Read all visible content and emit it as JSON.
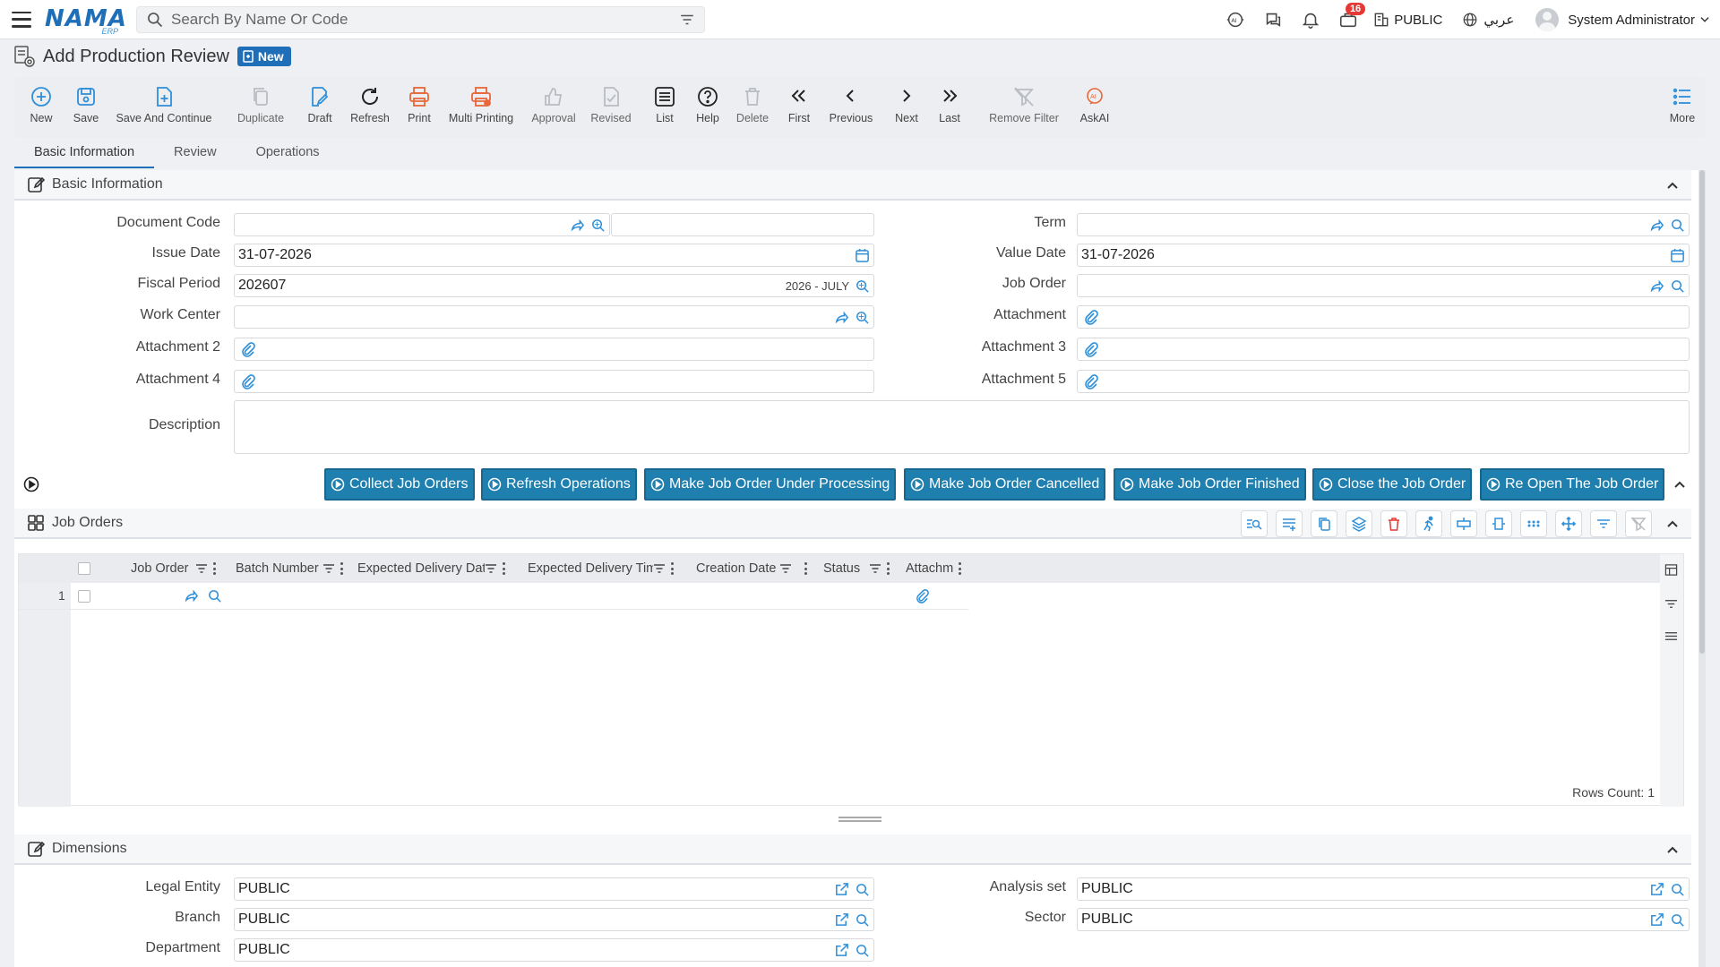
{
  "topbar": {
    "logo_text": "NAMA",
    "logo_sub": "ERP",
    "search_placeholder": "Search By Name Or Code",
    "notifications_count": "16",
    "company": "PUBLIC",
    "language": "عربي",
    "user_name": "System Administrator"
  },
  "page": {
    "title": "Add Production Review",
    "status_badge": "New"
  },
  "toolbar": {
    "new": "New",
    "save": "Save",
    "save_continue": "Save And Continue",
    "duplicate": "Duplicate",
    "draft": "Draft",
    "refresh": "Refresh",
    "print": "Print",
    "multi_printing": "Multi Printing",
    "approval": "Approval",
    "revised": "Revised",
    "list": "List",
    "help": "Help",
    "delete": "Delete",
    "first": "First",
    "previous": "Previous",
    "next": "Next",
    "last": "Last",
    "remove_filter": "Remove Filter",
    "askai": "AskAI",
    "more": "More"
  },
  "tabs": [
    "Basic Information",
    "Review",
    "Operations"
  ],
  "basic_info": {
    "section_title": "Basic Information",
    "labels": {
      "document_code": "Document Code",
      "issue_date": "Issue Date",
      "fiscal_period": "Fiscal Period",
      "work_center": "Work Center",
      "attachment_2": "Attachment 2",
      "attachment_4": "Attachment 4",
      "description": "Description",
      "term": "Term",
      "value_date": "Value Date",
      "job_order": "Job Order",
      "attachment": "Attachment",
      "attachment_3": "Attachment 3",
      "attachment_5": "Attachment 5"
    },
    "values": {
      "issue_date": "31-07-2026",
      "value_date": "31-07-2026",
      "fiscal_period": "202607",
      "fiscal_period_name": "2026 - JULY"
    }
  },
  "actions": [
    "Collect Job Orders",
    "Refresh Operations",
    "Make Job Order Under Processing",
    "Make Job Order Cancelled",
    "Make Job Order Finished",
    "Close the Job Order",
    "Re Open The Job Order"
  ],
  "job_orders": {
    "section_title": "Job Orders",
    "columns": [
      "Job Order",
      "Batch Number",
      "Expected Delivery Date",
      "Expected Delivery Tim",
      "Creation Date",
      "Status",
      "Attachm"
    ],
    "rows": [
      {
        "num": "1"
      }
    ],
    "rows_count": "Rows Count: 1"
  },
  "dimensions": {
    "section_title": "Dimensions",
    "labels": {
      "legal_entity": "Legal Entity",
      "branch": "Branch",
      "department": "Department",
      "analysis_set": "Analysis set",
      "sector": "Sector"
    },
    "values": {
      "legal_entity": "PUBLIC",
      "branch": "PUBLIC",
      "department": "PUBLIC",
      "analysis_set": "PUBLIC",
      "sector": "PUBLIC"
    }
  },
  "colors": {
    "accent": "#1f6fb8",
    "action_button": "#1f7fae",
    "orange_icon": "#e8673a",
    "icon_blue": "#2f8fd8"
  }
}
